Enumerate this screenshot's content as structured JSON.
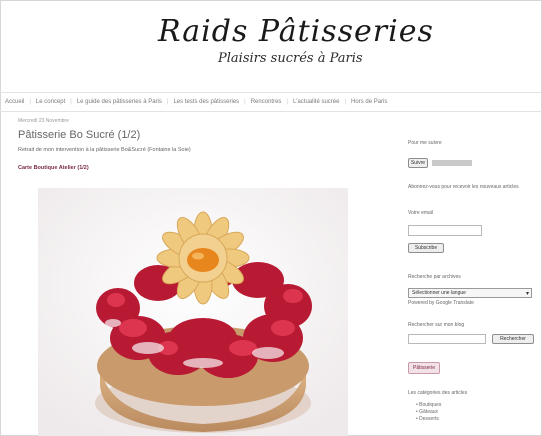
{
  "site": {
    "title": "Raids Pâtisseries",
    "tagline": "Plaisirs sucrés à Paris"
  },
  "nav": {
    "items": [
      "Accueil",
      "Le concept",
      "Le guide des pâtisseries à Paris",
      "Les tests des pâtisseries",
      "Rencontres",
      "L'actualité sucrée",
      "Hors de Paris"
    ]
  },
  "post": {
    "breadcrumb": "Mercredi 23 Novembre",
    "title": "Pâtisserie Bo Sucré (1/2)",
    "intro": "Retrait de mon intervention à la pâtisserie Bo&Sucré (Fontaine la Soie)",
    "link": "Carte Boutique Atelier (1/2)"
  },
  "sidebar": {
    "follow_title": "Pour me suivre",
    "follow_count": "Suivre",
    "subscribe_text": "Abonnez-vous pour recevoir les nouveaux articles",
    "email_label": "Votre email",
    "email_placeholder": "",
    "subscribe_button": "Subscribe",
    "archive_title": "Recherche par archives",
    "archive_select": "Sélectionner une langue",
    "translate_label": "Powered by Google Translate",
    "search_title": "Rechercher sur mon blog",
    "search_button": "Rechercher",
    "ad_label": "Pâtisserie",
    "categories_title": "Les catégories des articles",
    "categories": [
      "Boutiques",
      "Gâteaux",
      "Desserts"
    ]
  },
  "colors": {
    "accent": "#7a2a48",
    "nav_text": "#7a7a7a",
    "raspberry": "#c8203a"
  }
}
